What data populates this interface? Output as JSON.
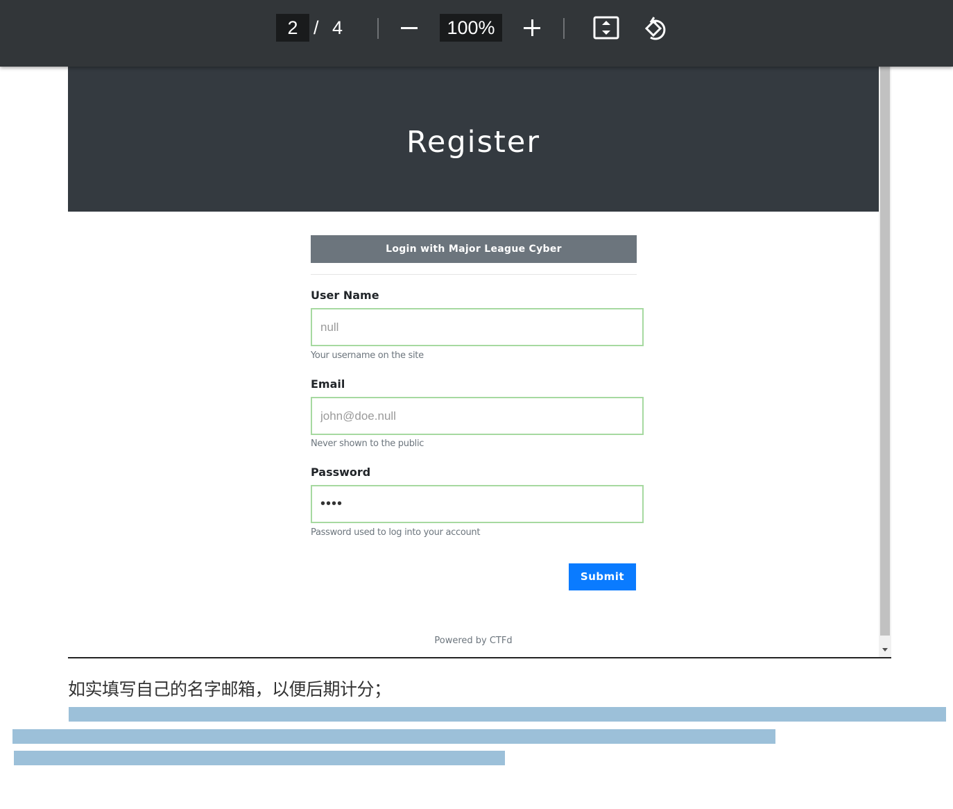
{
  "toolbar": {
    "current_page": "2",
    "page_separator": "/",
    "total_pages": "4",
    "zoom": "100%",
    "icons": [
      "zoom-out-icon",
      "zoom-in-icon",
      "fit-to-page-icon",
      "rotate-icon"
    ]
  },
  "page": {
    "title": "Register",
    "mlc_button": "Login with Major League Cyber",
    "fields": {
      "username": {
        "label": "User Name",
        "placeholder": "null",
        "help": "Your username on the site"
      },
      "email": {
        "label": "Email",
        "placeholder": "john@doe.null",
        "help": "Never shown to the public"
      },
      "password": {
        "label": "Password",
        "value": "••••",
        "help": "Password used to log into your account"
      }
    },
    "submit": "Submit",
    "footer": "Powered by CTFd"
  },
  "article": {
    "caption": "如实填写自己的名字邮箱，以便后期计分；"
  },
  "colors": {
    "toolbar_bg": "#323639",
    "header_bg": "#343a40",
    "mlc_bg": "#6c757d",
    "submit_bg": "#0a7bff",
    "field_border": "#a6d9a0",
    "redaction": "#9cc0d9"
  }
}
